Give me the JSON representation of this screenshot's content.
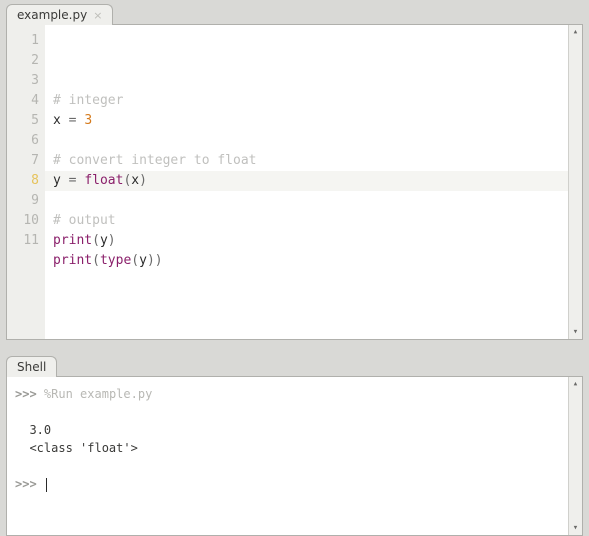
{
  "editor": {
    "tab_label": "example.py",
    "current_line": 8,
    "lines": [
      {
        "n": 1,
        "tokens": []
      },
      {
        "n": 2,
        "tokens": [
          {
            "t": "# integer",
            "c": "comment"
          }
        ]
      },
      {
        "n": 3,
        "tokens": [
          {
            "t": "x",
            "c": "name"
          },
          {
            "t": " = ",
            "c": "op"
          },
          {
            "t": "3",
            "c": "num"
          }
        ]
      },
      {
        "n": 4,
        "tokens": []
      },
      {
        "n": 5,
        "tokens": [
          {
            "t": "# convert integer to float",
            "c": "comment"
          }
        ]
      },
      {
        "n": 6,
        "tokens": [
          {
            "t": "y",
            "c": "name"
          },
          {
            "t": " = ",
            "c": "op"
          },
          {
            "t": "float",
            "c": "builtin"
          },
          {
            "t": "(",
            "c": "punc"
          },
          {
            "t": "x",
            "c": "name"
          },
          {
            "t": ")",
            "c": "punc"
          }
        ]
      },
      {
        "n": 7,
        "tokens": []
      },
      {
        "n": 8,
        "tokens": [
          {
            "t": "# output",
            "c": "comment"
          }
        ]
      },
      {
        "n": 9,
        "tokens": [
          {
            "t": "print",
            "c": "builtin"
          },
          {
            "t": "(",
            "c": "punc"
          },
          {
            "t": "y",
            "c": "name"
          },
          {
            "t": ")",
            "c": "punc"
          }
        ]
      },
      {
        "n": 10,
        "tokens": [
          {
            "t": "print",
            "c": "builtin"
          },
          {
            "t": "(",
            "c": "punc"
          },
          {
            "t": "type",
            "c": "builtin"
          },
          {
            "t": "(",
            "c": "punc"
          },
          {
            "t": "y",
            "c": "name"
          },
          {
            "t": ")",
            "c": "punc"
          },
          {
            "t": ")",
            "c": "punc"
          }
        ]
      },
      {
        "n": 11,
        "tokens": []
      }
    ]
  },
  "shell": {
    "tab_label": "Shell",
    "prompt": ">>>",
    "run_command": "%Run example.py",
    "output_lines": [
      "3.0",
      "<class 'float'>"
    ]
  }
}
